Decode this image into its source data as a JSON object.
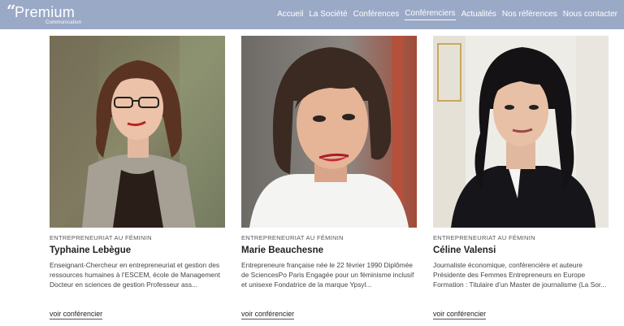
{
  "brand": {
    "mark": "“",
    "name": "Premium",
    "sub": "Communication"
  },
  "nav": [
    {
      "label": "Accueil"
    },
    {
      "label": "La Société"
    },
    {
      "label": "Conférences"
    },
    {
      "label": "Conférenciers",
      "active": true
    },
    {
      "label": "Actualités"
    },
    {
      "label": "Nos références"
    },
    {
      "label": "Nous contacter"
    }
  ],
  "cards": [
    {
      "category": "ENTREPRENEURIAT AU FÉMININ",
      "name": "Typhaine Lebègue",
      "description": "Enseignant-Chercheur en entrepreneuriat et gestion des ressources humaines à l’ESCEM, école de Management Docteur en sciences de gestion Professeur ass...",
      "link": "voir conférencier"
    },
    {
      "category": "ENTREPRENEURIAT AU FÉMININ",
      "name": "Marie Beauchesne",
      "description": "Entrepreneure française née le 22 février 1990 Diplômée de SciencesPo Paris Engagée pour un féminisme inclusif et unisexe Fondatrice de la marque Ypsyl...",
      "link": "voir conférencier"
    },
    {
      "category": "ENTREPRENEURIAT AU FÉMININ",
      "name": "Céline Valensi",
      "description": "Journaliste économique, conférencière et auteure Présidente des Femmes Entrepreneurs en Europe Formation : Titulaire d’un Master de journalisme (La Sor...",
      "link": "voir conférencier"
    }
  ],
  "colors": {
    "header": "#9aa9c6",
    "text": "#333333"
  }
}
